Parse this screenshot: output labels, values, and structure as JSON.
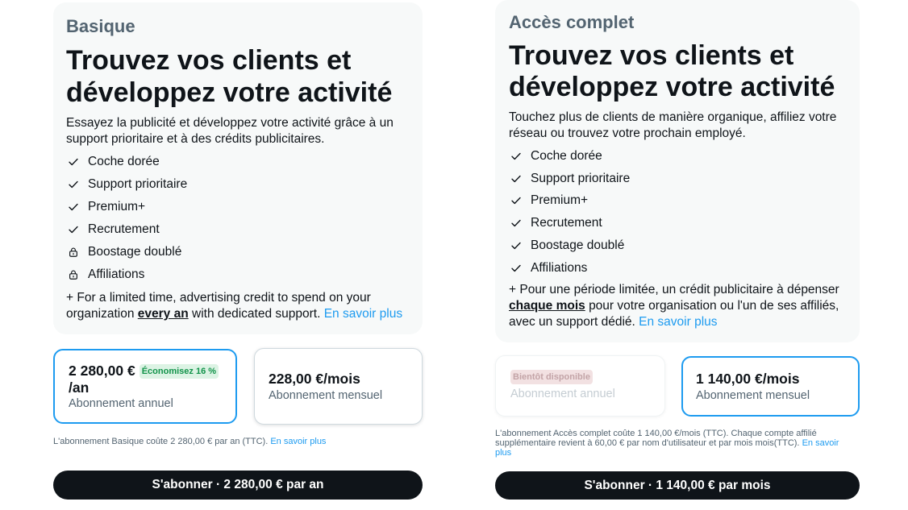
{
  "theme": {
    "accent": "#1d9bf0",
    "text": "#0f1419",
    "secondary": "#536471",
    "card_background": "#f7f9f9",
    "cta_background": "#0f1419",
    "cta_text": "#ffffff",
    "savings_badge_background": "#dcf3e4",
    "savings_badge_text": "#12934a",
    "soon_badge_background": "#f2e1e2",
    "soon_badge_text": "#c3a4a7"
  },
  "plans": [
    {
      "tier": "Basique",
      "headline": "Trouvez vos clients et développez votre activité",
      "description": "Essayez la publicité et développez votre activité grâce à un support prioritaire et à des crédits publicitaires.",
      "features": [
        {
          "label": "Coche dorée",
          "icon": "check-icon",
          "included": true
        },
        {
          "label": "Support prioritaire",
          "icon": "check-icon",
          "included": true
        },
        {
          "label": "Premium+",
          "icon": "check-icon",
          "included": true
        },
        {
          "label": "Recrutement",
          "icon": "check-icon",
          "included": true
        },
        {
          "label": "Boostage doublé",
          "icon": "lock-icon",
          "included": false
        },
        {
          "label": "Affiliations",
          "icon": "lock-icon",
          "included": false
        }
      ],
      "promo": {
        "text_before": "+ For a limited time, advertising credit to spend on your organization",
        "emphasis": "every an",
        "text_after": "with dedicated support.",
        "link": "En savoir plus"
      },
      "options": [
        {
          "price": "2 280,00 €",
          "period": "/an",
          "badge": "Économisez 16 %",
          "label": "Abonnement annuel",
          "selected": true,
          "available": true
        },
        {
          "price": "228,00 €/mois",
          "label": "Abonnement mensuel",
          "selected": false,
          "available": true
        }
      ],
      "fine_print": {
        "text": "L'abonnement Basique coûte 2 280,00 € par an (TTC).",
        "link": "En savoir plus"
      },
      "cta": "S'abonner · 2 280,00 € par an"
    },
    {
      "tier": "Accès complet",
      "headline": "Trouvez vos clients et développez votre activité",
      "description": "Touchez plus de clients de manière organique, affiliez votre réseau ou trouvez votre prochain employé.",
      "features": [
        {
          "label": "Coche dorée",
          "icon": "check-icon",
          "included": true
        },
        {
          "label": "Support prioritaire",
          "icon": "check-icon",
          "included": true
        },
        {
          "label": "Premium+",
          "icon": "check-icon",
          "included": true
        },
        {
          "label": "Recrutement",
          "icon": "check-icon",
          "included": true
        },
        {
          "label": "Boostage doublé",
          "icon": "check-icon",
          "included": true
        },
        {
          "label": "Affiliations",
          "icon": "check-icon",
          "included": true
        }
      ],
      "promo": {
        "text_before": "+ Pour une période limitée, un crédit publicitaire à dépenser",
        "emphasis": "chaque mois",
        "text_after": "pour votre organisation ou l'un de ses affiliés, avec un support dédié.",
        "link": "En savoir plus"
      },
      "options": [
        {
          "badge": "Bientôt disponible",
          "label": "Abonnement annuel",
          "selected": false,
          "available": false
        },
        {
          "price": "1 140,00 €/mois",
          "label": "Abonnement mensuel",
          "selected": true,
          "available": true
        }
      ],
      "fine_print": {
        "text": "L'abonnement Accès complet coûte 1 140,00 €/mois (TTC). Chaque compte affilié supplémentaire revient à 60,00 € par nom d'utilisateur et par mois mois(TTC).",
        "link": "En savoir plus"
      },
      "cta": "S'abonner · 1 140,00 € par mois"
    }
  ]
}
